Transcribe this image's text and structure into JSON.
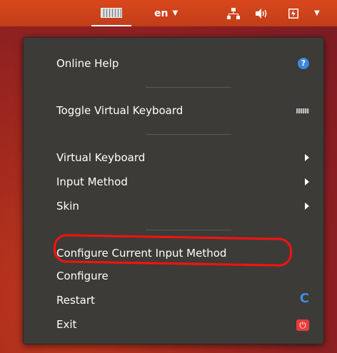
{
  "topbar": {
    "keyboard_icon": "keyboard-icon",
    "language": "en",
    "language_caret": "▼",
    "network_icon": "network-icon",
    "volume_icon": "volume-icon",
    "battery_icon": "battery-icon",
    "system_caret": "▼"
  },
  "menu": {
    "items": [
      {
        "label": "Online Help",
        "icon": "help-icon"
      },
      {
        "label": "Toggle Virtual Keyboard",
        "icon": "keyboard-icon"
      },
      {
        "label": "Virtual Keyboard",
        "icon": "submenu-arrow-icon"
      },
      {
        "label": "Input Method",
        "icon": "submenu-arrow-icon"
      },
      {
        "label": "Skin",
        "icon": "submenu-arrow-icon"
      },
      {
        "label": "Configure Current Input Method",
        "icon": ""
      },
      {
        "label": "Configure",
        "icon": ""
      },
      {
        "label": "Restart",
        "icon": "restart-icon"
      },
      {
        "label": "Exit",
        "icon": "power-icon"
      }
    ],
    "help_glyph": "?",
    "restart_glyph": "C",
    "exit_glyph": "⏻"
  },
  "colors": {
    "accent_blue": "#3b87dc",
    "exit_red": "#ea3b3b",
    "highlight_red": "#ff1010",
    "menu_bg": "#3c3b37",
    "topbar": "#d9471c"
  }
}
